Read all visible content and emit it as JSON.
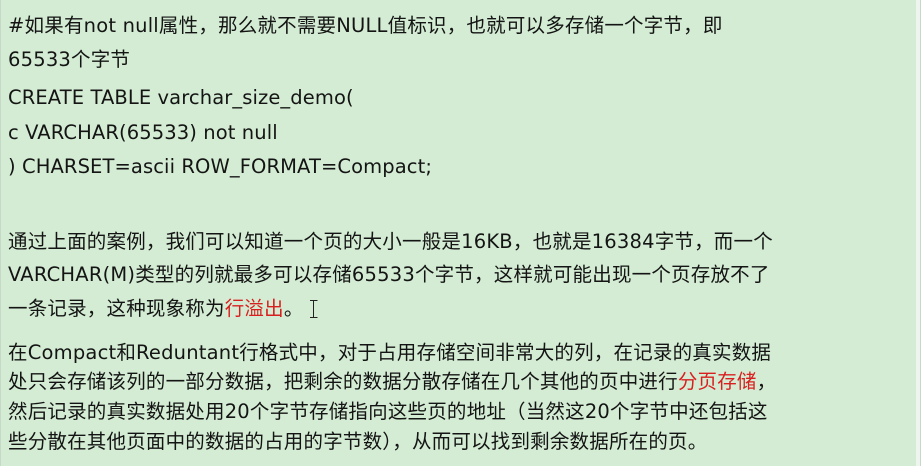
{
  "section1": {
    "comment_line1": "#如果有not null属性，那么就不需要NULL值标识，也就可以多存储一个字节，即",
    "comment_line2": "65533个字节",
    "code_line1": "CREATE  TABLE  varchar_size_demo(",
    "code_line2": " c  VARCHAR(65533)  not  null",
    "code_line3": ")  CHARSET=ascii  ROW_FORMAT=Compact;"
  },
  "section2": {
    "line1": "通过上面的案例，我们可以知道一个页的大小一般是16KB，也就是16384字节，而一个",
    "line2": "VARCHAR(M)类型的列就最多可以存储65533个字节，这样就可能出现一个页存放不了",
    "line3_prefix": "一条记录，这种现象称为",
    "line3_highlight": "行溢出",
    "line3_suffix": "。"
  },
  "section3": {
    "line1": "在Compact和Reduntant行格式中，对于占用存储空间非常大的列，在记录的真实数据",
    "line2_prefix": "处只会存储该列的一部分数据，把剩余的数据分散存储在几个其他的页中进行",
    "line2_highlight": "分页存储",
    "line2_suffix": "，",
    "line3": "然后记录的真实数据处用20个字节存储指向这些页的地址（当然这20个字节中还包括这",
    "line4": "些分散在其他页面中的数据的占用的字节数），从而可以找到剩余数据所在的页。"
  },
  "colors": {
    "background": "#d3ecd3",
    "text": "#141414",
    "highlight": "#d82020"
  }
}
